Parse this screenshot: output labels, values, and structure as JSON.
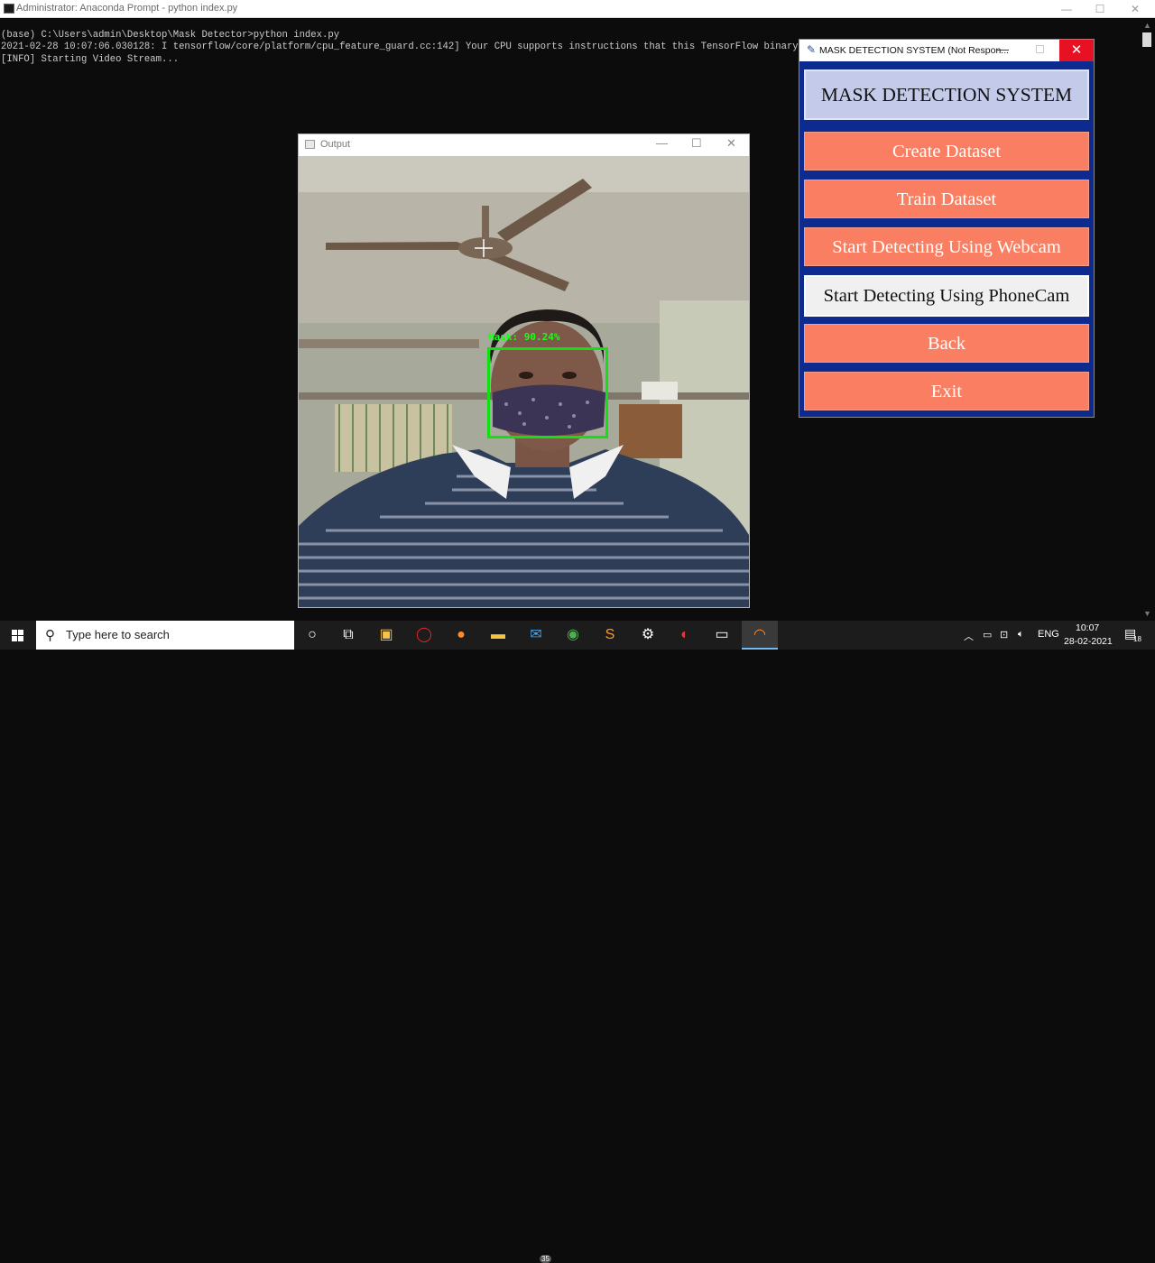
{
  "console": {
    "title": "Administrator: Anaconda Prompt - python  index.py",
    "lines": [
      "(base) C:\\Users\\admin\\Desktop\\Mask Detector>python index.py",
      "2021-02-28 10:07:06.030128: I tensorflow/core/platform/cpu_feature_guard.cc:142] Your CPU supports instructions that this TensorFlow binary was not",
      "[INFO] Starting Video Stream..."
    ],
    "controls": {
      "minimize": "—",
      "maximize": "☐",
      "close": "✕"
    }
  },
  "output_window": {
    "title": "Output",
    "controls": {
      "minimize": "—",
      "maximize": "☐",
      "close": "✕"
    },
    "detection_label": "Mask: 90.24%"
  },
  "app": {
    "title": "MASK DETECTION SYSTEM (Not Respon...",
    "controls": {
      "minimize": "—",
      "close": "✕"
    },
    "header": "MASK DETECTION SYSTEM",
    "buttons": {
      "create": "Create Dataset",
      "train": "Train Dataset",
      "webcam": "Start Detecting Using Webcam",
      "phonecam": "Start Detecting Using PhoneCam",
      "back": "Back",
      "exit": "Exit"
    },
    "colors": {
      "button": "#fa7f62",
      "background": "#0d2b8f",
      "header": "#c4cbea",
      "close": "#e81123"
    }
  },
  "taskbar": {
    "search_placeholder": "Type here to search",
    "mail_badge": "35",
    "language": "ENG",
    "time": "10:07",
    "date": "28-02-2021",
    "notifications": "18"
  }
}
